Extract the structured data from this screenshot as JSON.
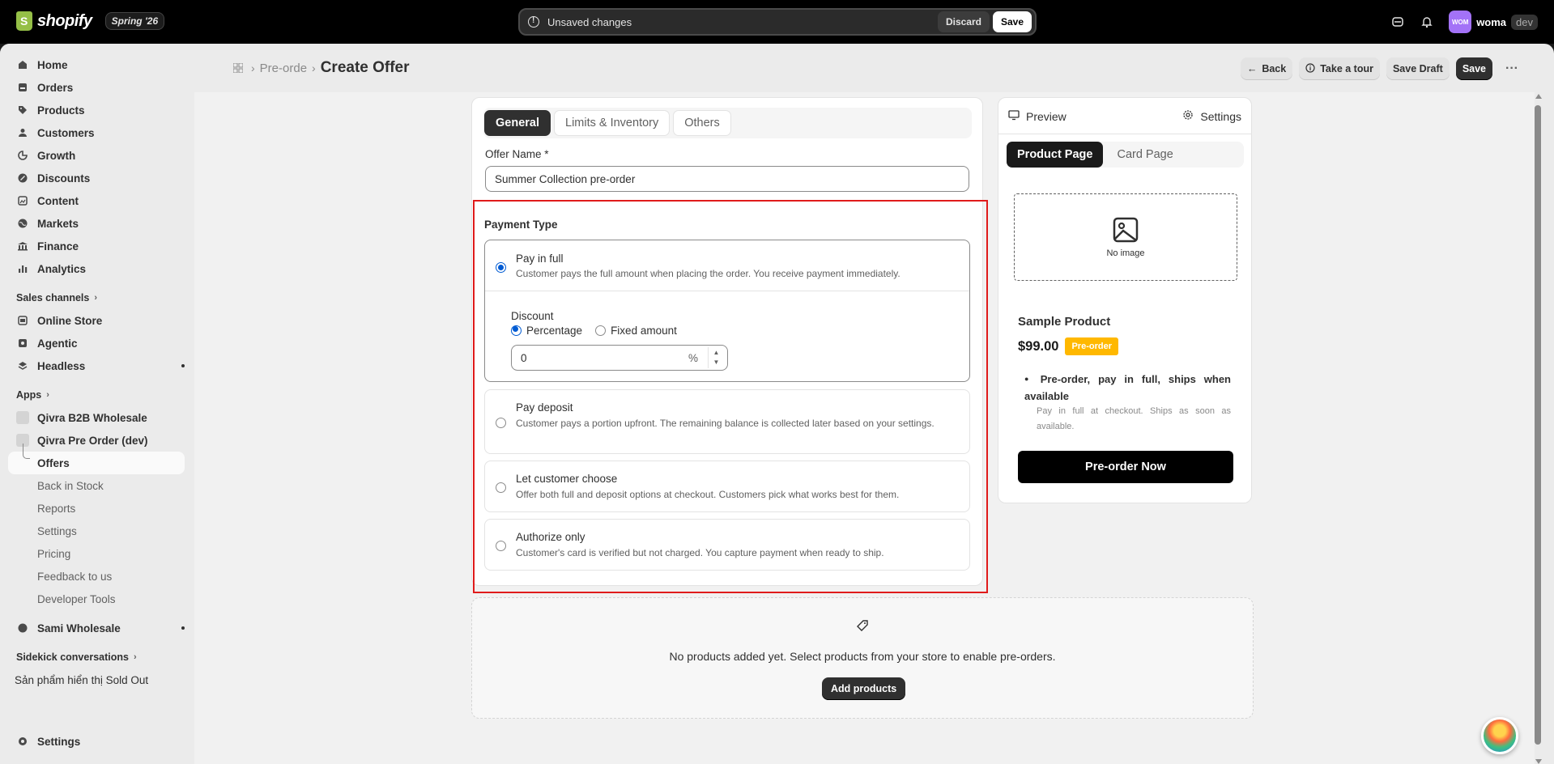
{
  "topbar": {
    "logo_text": "shopify",
    "badge": "Spring '26",
    "unsaved_text": "Unsaved changes",
    "discard_label": "Discard",
    "save_label": "Save",
    "avatar_initials": "WOM",
    "user_name": "woma",
    "user_tag": "dev"
  },
  "sidebar": {
    "main": [
      {
        "label": "Home",
        "icon": "home-icon"
      },
      {
        "label": "Orders",
        "icon": "orders-icon"
      },
      {
        "label": "Products",
        "icon": "tag-icon"
      },
      {
        "label": "Customers",
        "icon": "person-icon"
      },
      {
        "label": "Growth",
        "icon": "growth-icon"
      },
      {
        "label": "Discounts",
        "icon": "discount-icon"
      },
      {
        "label": "Content",
        "icon": "content-icon"
      },
      {
        "label": "Markets",
        "icon": "globe-icon"
      },
      {
        "label": "Finance",
        "icon": "bank-icon"
      },
      {
        "label": "Analytics",
        "icon": "bar-chart-icon"
      }
    ],
    "sales_channels_label": "Sales channels",
    "channels": [
      {
        "label": "Online Store"
      },
      {
        "label": "Agentic"
      },
      {
        "label": "Headless"
      }
    ],
    "apps_label": "Apps",
    "apps": [
      {
        "label": "Qivra B2B Wholesale"
      },
      {
        "label": "Qivra Pre Order (dev)"
      }
    ],
    "app_sub": [
      {
        "label": "Offers"
      },
      {
        "label": "Back in Stock"
      },
      {
        "label": "Reports"
      },
      {
        "label": "Settings"
      },
      {
        "label": "Pricing"
      },
      {
        "label": "Feedback to us"
      },
      {
        "label": "Developer Tools"
      }
    ],
    "other_app": "Sami Wholesale",
    "sidekick_label": "Sidekick conversations",
    "sidekick_item": "Sản phẩm hiển thị Sold Out",
    "settings_label": "Settings"
  },
  "header": {
    "breadcrumb_parent": "Pre-orde",
    "title": "Create Offer",
    "back_label": "Back",
    "tour_label": "Take a tour",
    "save_draft_label": "Save Draft",
    "save_label": "Save"
  },
  "form": {
    "tabs": [
      "General",
      "Limits & Inventory",
      "Others"
    ],
    "active_tab": "General",
    "offer_name_label": "Offer Name *",
    "offer_name_value": "Summer Collection pre-order",
    "payment_type_label": "Payment Type",
    "options": [
      {
        "title": "Pay in full",
        "desc": "Customer pays the full amount when placing the order. You receive payment immediately.",
        "selected": true
      },
      {
        "title": "Pay deposit",
        "desc": "Customer pays a portion upfront. The remaining balance is collected later based on your settings.",
        "selected": false
      },
      {
        "title": "Let customer choose",
        "desc": "Offer both full and deposit options at checkout. Customers pick what works best for them.",
        "selected": false
      },
      {
        "title": "Authorize only",
        "desc": "Customer's card is verified but not charged. You capture payment when ready to ship.",
        "selected": false
      }
    ],
    "discount": {
      "label": "Discount",
      "percentage_label": "Percentage",
      "fixed_label": "Fixed amount",
      "selected": "Percentage",
      "value": "0",
      "suffix": "%"
    }
  },
  "preview": {
    "preview_label": "Preview",
    "settings_label": "Settings",
    "tabs": [
      "Product Page",
      "Card Page"
    ],
    "active_tab": "Product Page",
    "no_image_label": "No image",
    "product_name": "Sample Product",
    "price": "$99.00",
    "badge": "Pre-order",
    "bullet_title": "Pre-order, pay in full, ships when available",
    "bullet_sub": "Pay in full at checkout. Ships as soon as available.",
    "button_label": "Pre-order Now"
  },
  "products": {
    "empty_text": "No products added yet. Select products from your store to enable pre-orders.",
    "add_label": "Add products"
  },
  "colors": {
    "accent_blue": "#005bd3",
    "badge_yellow": "#ffb800",
    "highlight_red": "#e01b1b"
  }
}
